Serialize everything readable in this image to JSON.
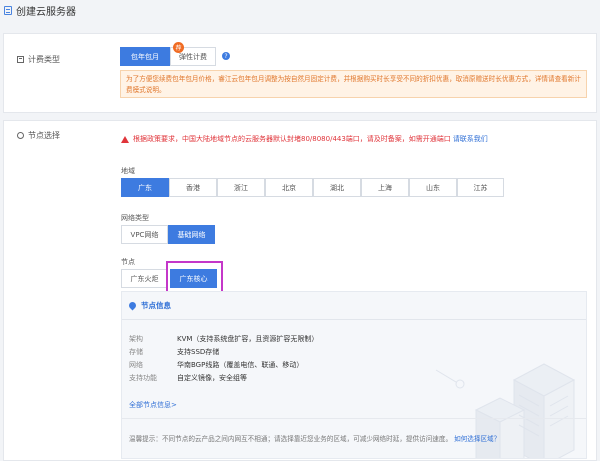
{
  "header": {
    "title": "创建云服务器"
  },
  "billing": {
    "label": "计费类型",
    "options": [
      "包年包月",
      "弹性计费"
    ],
    "badge": "荐",
    "help": "?",
    "notice": "为了方便您续费包年包月价格，睿江云包年包月调整为按自然月固定计费，并根据购买时长享受不同的折扣优惠，取消原赠送时长优惠方式，详情请查看新计费模式说明。"
  },
  "node": {
    "label": "节点选择",
    "alert_text": "根据政策要求，中国大陆地域节点的云服务器默认封堵80/8080/443端口，请及时备案，如需开通端口",
    "alert_link": "请联系我们",
    "region_label": "地域",
    "regions": [
      "广东",
      "香港",
      "浙江",
      "北京",
      "湖北",
      "上海",
      "山东",
      "江苏"
    ],
    "network_label": "网络类型",
    "networks": [
      "VPC网络",
      "基础网络"
    ],
    "node_label": "节点",
    "nodes": [
      "广东火炬",
      "广东核心"
    ]
  },
  "info": {
    "title": "节点信息",
    "rows": [
      {
        "key": "架构",
        "value": "KVM（支持系统盘扩容，且资源扩容无限制）"
      },
      {
        "key": "存储",
        "value": "支持SSD存储"
      },
      {
        "key": "网络",
        "value": "华南BGP线路（覆盖电信、联通、移动）"
      },
      {
        "key": "支持功能",
        "value": "自定义镜像，安全组等"
      }
    ],
    "all_link": "全部节点信息>",
    "tip": "温馨提示：不同节点的云产品之间内网互不相通；请选择靠近您业务的区域，可减少网络时延，提供访问速度。",
    "tip_link": "如何选择区域？"
  },
  "colors": {
    "primary": "#3d7be0",
    "warning": "#e0762b",
    "danger": "#e0343a",
    "highlight": "#c437c9"
  }
}
